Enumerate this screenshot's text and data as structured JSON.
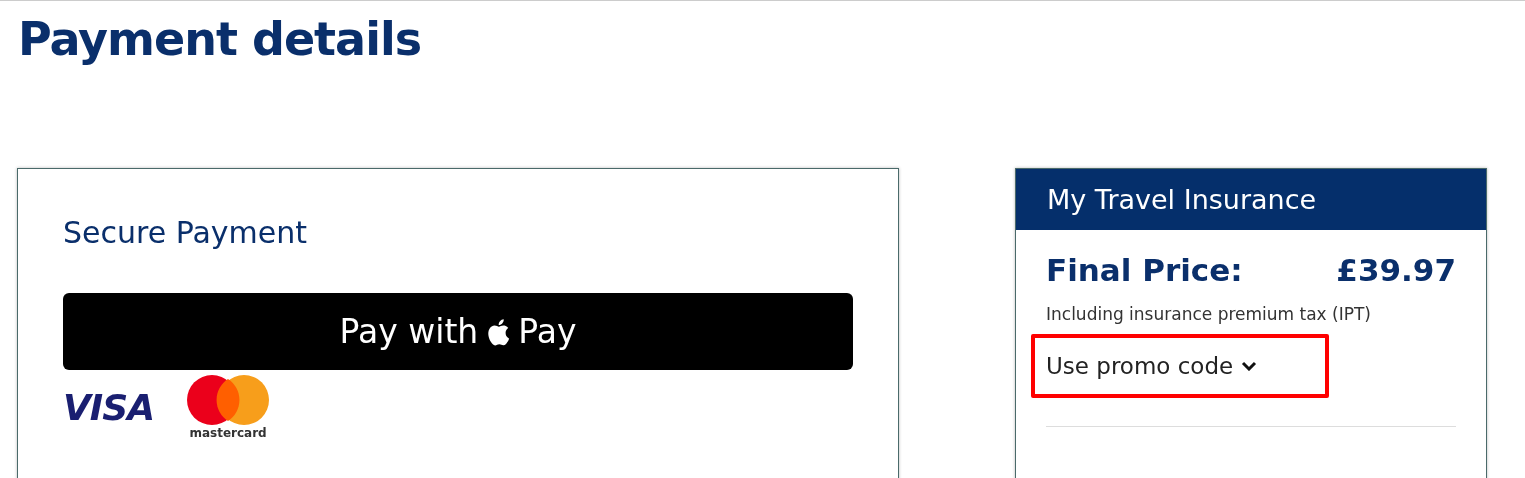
{
  "page": {
    "title": "Payment details"
  },
  "payment": {
    "title": "Secure Payment",
    "pay_button": {
      "prefix": "Pay with",
      "suffix": "Pay"
    },
    "card_logos": [
      {
        "kind": "visa",
        "label": "VISA"
      },
      {
        "kind": "mastercard",
        "label": "mastercard"
      }
    ]
  },
  "summary": {
    "title": "My Travel Insurance",
    "price_label": "Final Price:",
    "price": "£39.97",
    "tax_note": "Including insurance premium tax (IPT)",
    "promo": {
      "label": "Use promo code",
      "expanded": false,
      "highlighted": true
    }
  }
}
